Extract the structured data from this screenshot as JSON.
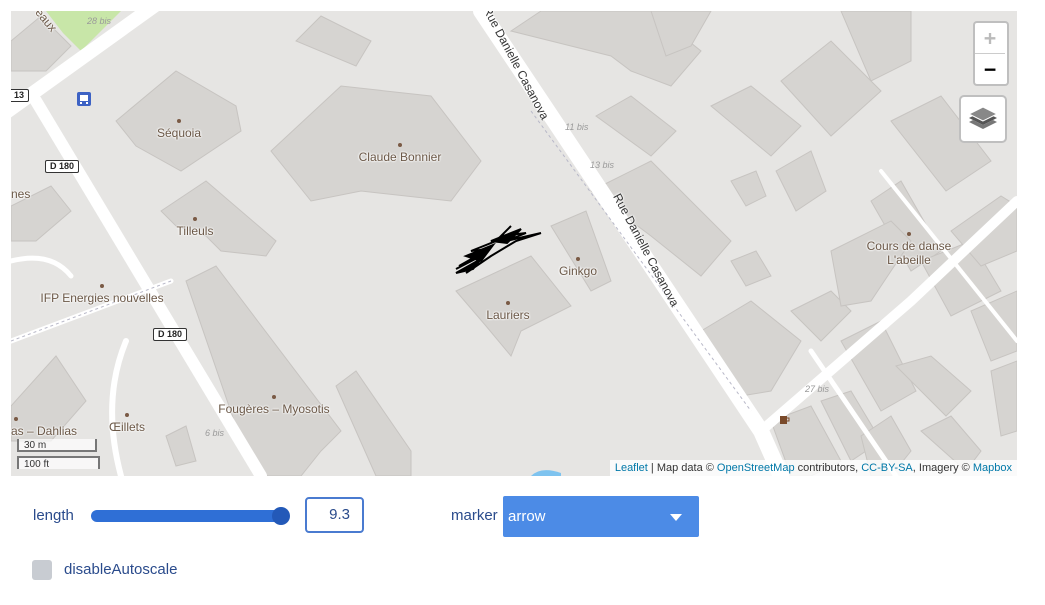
{
  "map": {
    "places": [
      {
        "name": "Séquoia"
      },
      {
        "name": "Claude Bonnier"
      },
      {
        "name": "Tilleuls"
      },
      {
        "name": "IFP Energies nouvelles"
      },
      {
        "name": "Ginkgo"
      },
      {
        "name": "Lauriers"
      },
      {
        "name": "Cours de danse"
      },
      {
        "name": "L'abeille"
      },
      {
        "name": "Fougères – Myosotis"
      },
      {
        "name": "Œillets"
      },
      {
        "name": "as – Dahlias"
      },
      {
        "name": "nes"
      },
      {
        "name": "eaux"
      }
    ],
    "streets": {
      "top": "Rue Danielle Casanova",
      "middle": "Rue Danielle Casanova"
    },
    "road_shields": {
      "first": "D 180",
      "second": "D 180",
      "partial": "13"
    },
    "house_numbers": {
      "a": "28 bis",
      "b": "11 bis",
      "c": "13 bis",
      "d": "6 bis",
      "e": "27 bis"
    },
    "zoom": {
      "in": "+",
      "out": "−"
    },
    "scale": {
      "metric": "30 m",
      "imperial": "100 ft"
    },
    "attribution": {
      "leaflet": "Leaflet",
      "sep1": " | Map data © ",
      "osm": "OpenStreetMap",
      "sep2": " contributors, ",
      "license": "CC-BY-SA",
      "sep3": ", Imagery © ",
      "mapbox": "Mapbox"
    },
    "icons": {
      "layers": "layers-icon",
      "bus": "bus-stop-icon",
      "cafe": "cafe-icon"
    }
  },
  "controls": {
    "length_label": "length",
    "length_value": "9.3",
    "length_fraction": 1.0,
    "marker_label": "marker",
    "marker_value": "arrow",
    "autoscale_label": "disableAutoscale",
    "autoscale_checked": false
  }
}
